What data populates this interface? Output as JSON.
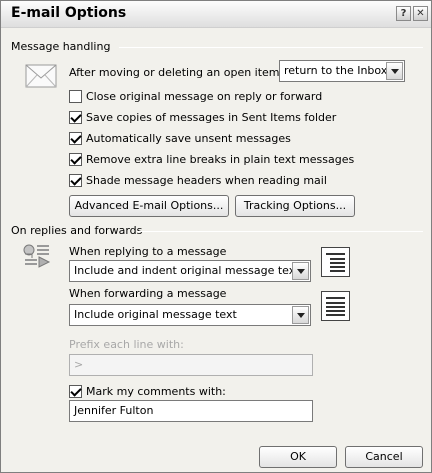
{
  "window": {
    "title": "E-mail Options",
    "help_glyph": "?",
    "close_glyph": "✕"
  },
  "message_handling": {
    "heading": "Message handling",
    "after_move_label": "After moving or deleting an open item:",
    "after_move_value": "return to the Inbox",
    "checkboxes": [
      {
        "label": "Close original message on reply or forward",
        "checked": false
      },
      {
        "label": "Save copies of messages in Sent Items folder",
        "checked": true
      },
      {
        "label": "Automatically save unsent messages",
        "checked": true
      },
      {
        "label": "Remove extra line breaks in plain text messages",
        "checked": true
      },
      {
        "label": "Shade message headers when reading mail",
        "checked": true
      }
    ],
    "advanced_button": "Advanced E-mail Options...",
    "tracking_button": "Tracking Options..."
  },
  "replies": {
    "heading": "On replies and forwards",
    "reply_label": "When replying to a message",
    "reply_value": "Include and indent original message text",
    "forward_label": "When forwarding a message",
    "forward_value": "Include original message text",
    "prefix_label": "Prefix each line with:",
    "prefix_value": ">",
    "mark_label": "Mark my comments with:",
    "mark_checked": true,
    "mark_value": "Jennifer Fulton"
  },
  "footer": {
    "ok": "OK",
    "cancel": "Cancel"
  },
  "icons": {
    "envelope": "envelope-icon",
    "reply_forward": "reply-forward-icon"
  }
}
